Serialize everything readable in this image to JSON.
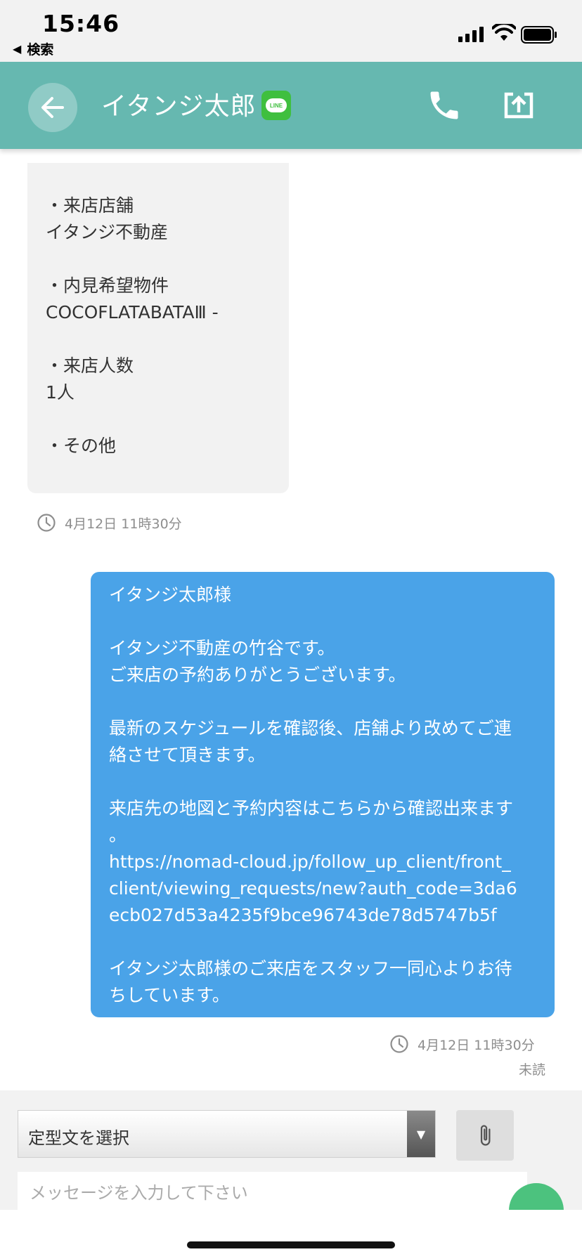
{
  "status_bar": {
    "time": "15:46",
    "back_label": "検索"
  },
  "header": {
    "title": "イタンジ太郎",
    "line_badge": "LINE",
    "accent_color": "#66b8b0",
    "icons": [
      "back-arrow-icon",
      "line-icon",
      "phone-icon",
      "export-icon"
    ]
  },
  "messages": {
    "incoming": {
      "lines": [
        "・来店店舗",
        "イタンジ不動産",
        "",
        "・内見希望物件",
        "COCOFLATABATAⅢ -",
        "",
        "・来店人数",
        "1人",
        "",
        "・その他"
      ],
      "timestamp": "4月12日 11時30分"
    },
    "outgoing": {
      "lines": [
        "イタンジ太郎様",
        "",
        "イタンジ不動産の竹谷です。",
        "ご来店の予約ありがとうございます。",
        "",
        "最新のスケジュールを確認後、店舗より改めてご連",
        "絡させて頂きます。",
        "",
        "来店先の地図と予約内容はこちらから確認出来ます",
        "。",
        "https://nomad-cloud.jp/follow_up_client/front_",
        "client/viewing_requests/new?auth_code=3da6",
        "ecb027d53a4235f9bce96743de78d5747b5f",
        "",
        "イタンジ太郎様のご来店をスタッフ一同心よりお待",
        "ちしています。"
      ],
      "timestamp": "4月12日 11時30分",
      "status": "未読",
      "bubble_color": "#4aa3e8"
    }
  },
  "input": {
    "template_select_label": "定型文を選択",
    "message_placeholder": "メッセージを入力して下さい"
  }
}
